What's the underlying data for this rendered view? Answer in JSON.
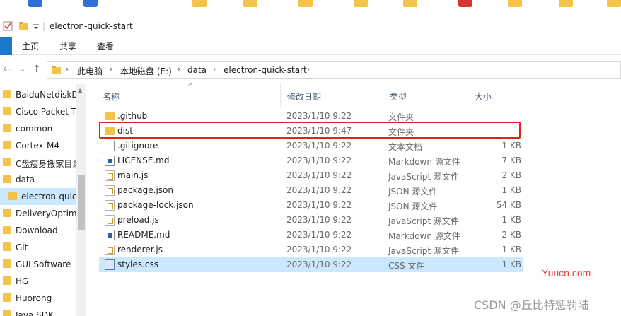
{
  "window": {
    "title": "electron-quick-start"
  },
  "ribbon": {
    "tabs": [
      "主页",
      "共享",
      "查看"
    ]
  },
  "address": {
    "crumbs": [
      "此电脑",
      "本地磁盘 (E:)",
      "data",
      "electron-quick-start"
    ]
  },
  "nav": {
    "items": [
      {
        "label": "BaiduNetdiskD"
      },
      {
        "label": "Cisco Packet T"
      },
      {
        "label": "common"
      },
      {
        "label": "Cortex-M4"
      },
      {
        "label": "C盘瘦身搬家目录"
      },
      {
        "label": "data"
      },
      {
        "label": "electron-quic",
        "selected": true
      },
      {
        "label": "DeliveryOptimi"
      },
      {
        "label": "Download"
      },
      {
        "label": "Git"
      },
      {
        "label": "GUI Software"
      },
      {
        "label": "HG"
      },
      {
        "label": "Huorong"
      },
      {
        "label": "Java SDK"
      }
    ]
  },
  "columns": {
    "name": "名称",
    "date": "修改日期",
    "type": "类型",
    "size": "大小"
  },
  "files": [
    {
      "name": ".github",
      "date": "2023/1/10 9:22",
      "type": "文件夹",
      "size": "",
      "icon": "folder"
    },
    {
      "name": "dist",
      "date": "2023/1/10 9:47",
      "type": "文件夹",
      "size": "",
      "icon": "folder"
    },
    {
      "name": ".gitignore",
      "date": "2023/1/10 9:22",
      "type": "文本文档",
      "size": "1 KB",
      "icon": "doc"
    },
    {
      "name": "LICENSE.md",
      "date": "2023/1/10 9:22",
      "type": "Markdown 源文件",
      "size": "7 KB",
      "icon": "docblue"
    },
    {
      "name": "main.js",
      "date": "2023/1/10 9:22",
      "type": "JavaScript 源文件",
      "size": "2 KB",
      "icon": "js"
    },
    {
      "name": "package.json",
      "date": "2023/1/10 9:22",
      "type": "JSON 源文件",
      "size": "1 KB",
      "icon": "js"
    },
    {
      "name": "package-lock.json",
      "date": "2023/1/10 9:22",
      "type": "JSON 源文件",
      "size": "54 KB",
      "icon": "js"
    },
    {
      "name": "preload.js",
      "date": "2023/1/10 9:22",
      "type": "JavaScript 源文件",
      "size": "1 KB",
      "icon": "js"
    },
    {
      "name": "README.md",
      "date": "2023/1/10 9:22",
      "type": "Markdown 源文件",
      "size": "2 KB",
      "icon": "docblue"
    },
    {
      "name": "renderer.js",
      "date": "2023/1/10 9:22",
      "type": "JavaScript 源文件",
      "size": "1 KB",
      "icon": "js"
    },
    {
      "name": "styles.css",
      "date": "2023/1/10 9:22",
      "type": "CSS 文件",
      "size": "1 KB",
      "icon": "css",
      "highlight": true
    }
  ],
  "watermarks": {
    "site": "Yuucn.com",
    "author": "CSDN @丘比特惩罚陆"
  },
  "colors": {
    "accent": "#1979ca",
    "selection": "#cce8ff",
    "annotation": "#e0231e"
  }
}
